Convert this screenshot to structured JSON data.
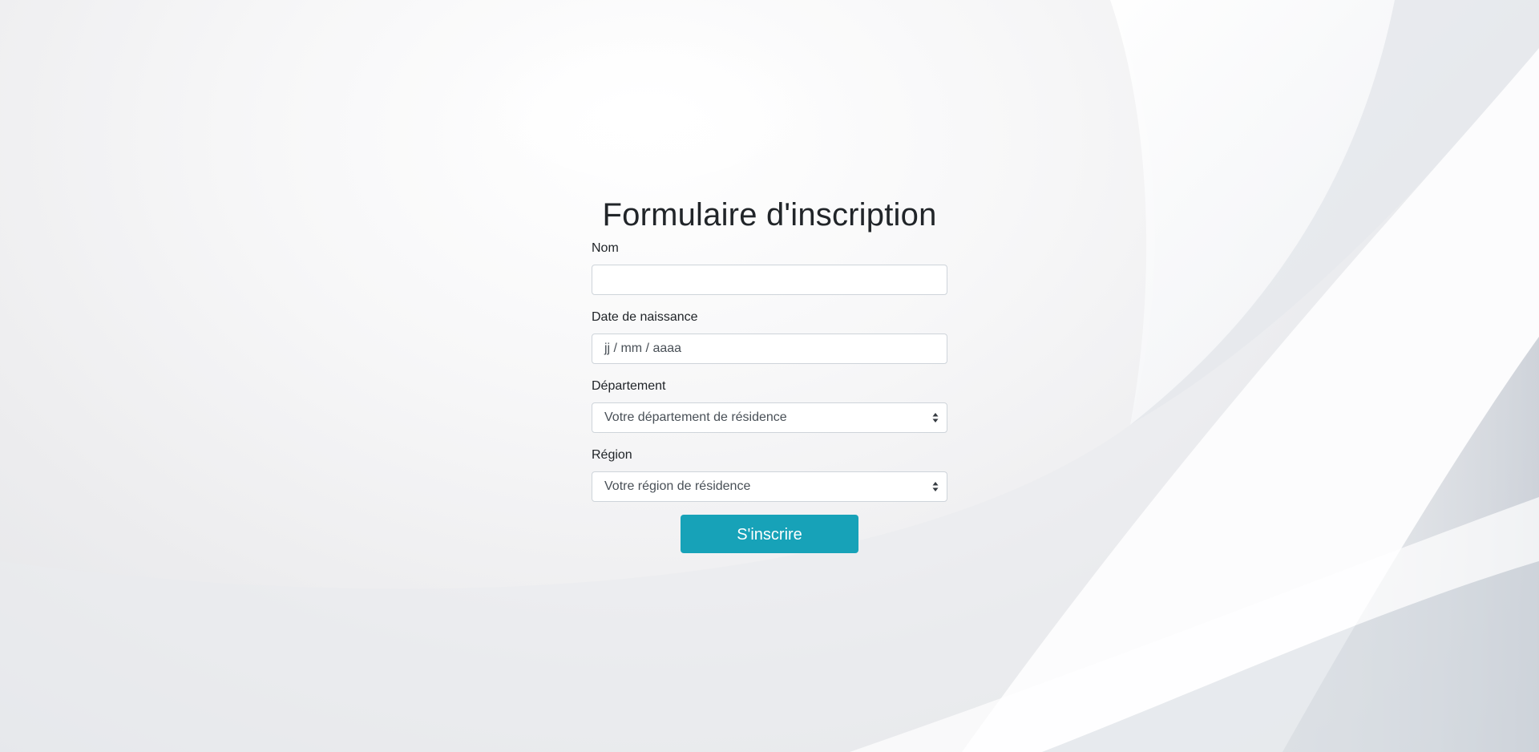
{
  "form": {
    "title": "Formulaire d'inscription",
    "nom": {
      "label": "Nom",
      "value": ""
    },
    "date_naissance": {
      "label": "Date de naissance",
      "placeholder": "jj / mm / aaaa"
    },
    "departement": {
      "label": "Département",
      "selected": "Votre département de résidence"
    },
    "region": {
      "label": "Région",
      "selected": "Votre région de résidence"
    },
    "submit_label": "S'inscrire"
  },
  "colors": {
    "button_bg": "#17a2b8",
    "button_text": "#ffffff",
    "input_border": "#ced4da"
  }
}
